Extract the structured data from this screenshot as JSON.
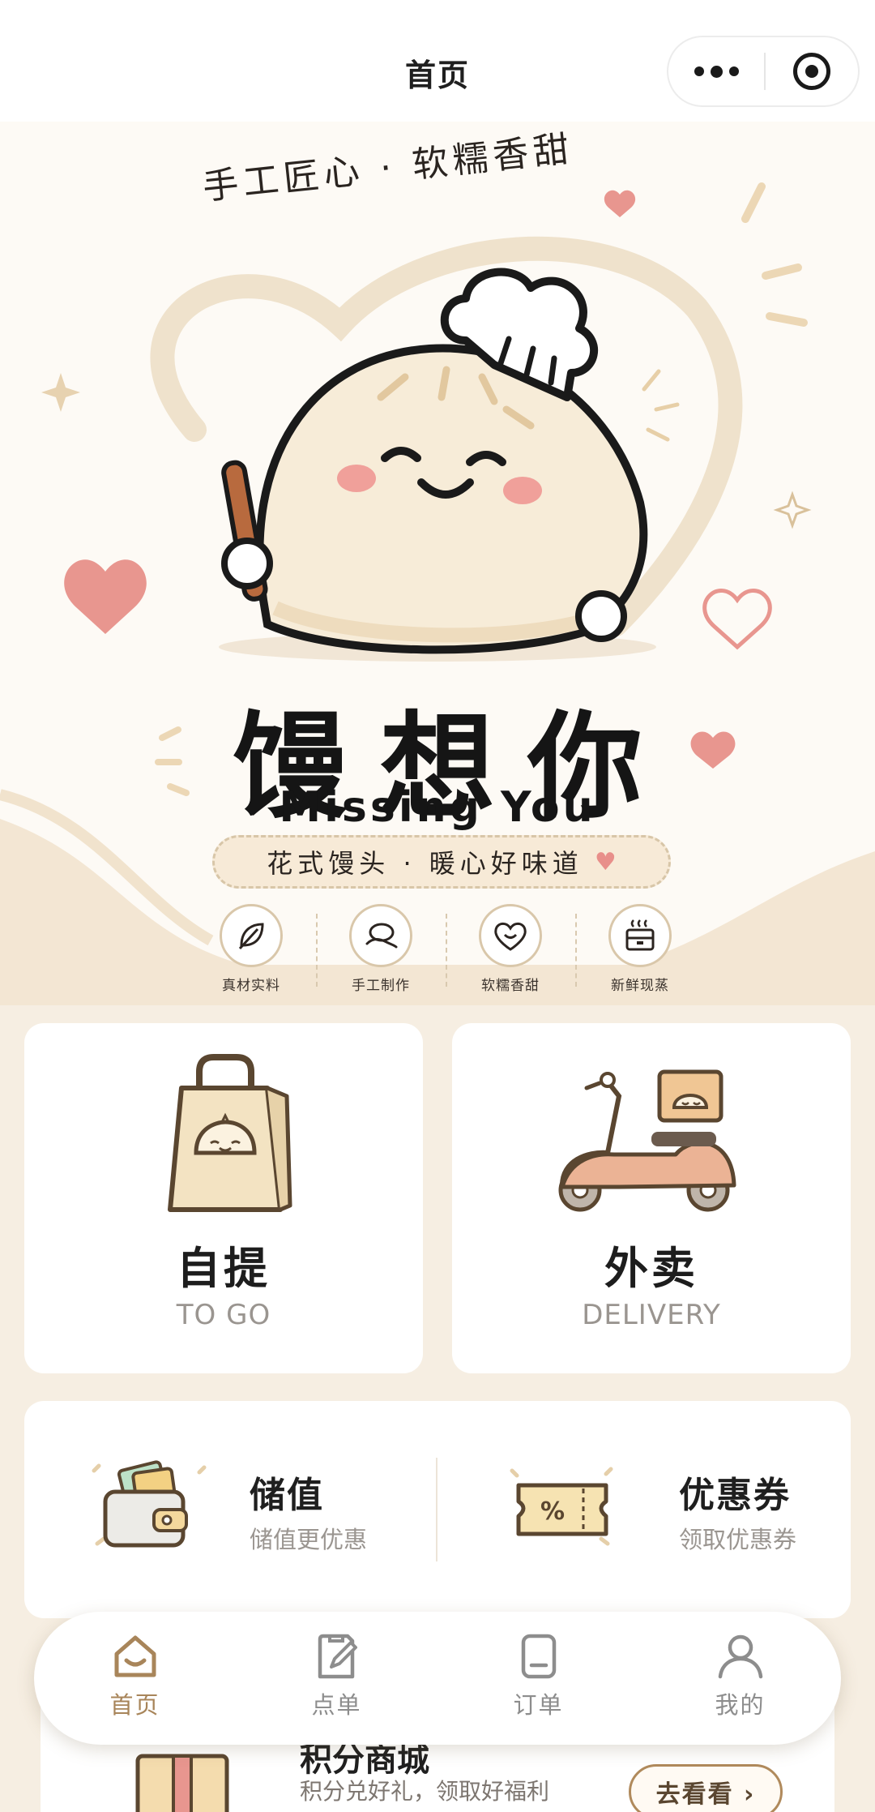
{
  "header": {
    "title": "首页",
    "more_icon": "more-dots-icon",
    "close_icon": "target-close-icon"
  },
  "banner": {
    "slogan": "手工匠心 · 软糯香甜",
    "brand_name": "馒想你",
    "brand_name_en": "Missing You",
    "tagline": "花式馒头 · 暖心好味道",
    "tagline_heart": "♥",
    "features": [
      {
        "label": "真材实料",
        "icon": "leaf-icon"
      },
      {
        "label": "手工制作",
        "icon": "hand-dough-icon"
      },
      {
        "label": "软糯香甜",
        "icon": "heart-smile-icon"
      },
      {
        "label": "新鲜现蒸",
        "icon": "steamer-icon"
      }
    ]
  },
  "order_options": [
    {
      "title": "自提",
      "subtitle": "TO GO",
      "icon": "shopping-bag-icon"
    },
    {
      "title": "外卖",
      "subtitle": "DELIVERY",
      "icon": "scooter-icon"
    }
  ],
  "services": [
    {
      "title": "储值",
      "subtitle": "储值更优惠",
      "icon": "wallet-icon"
    },
    {
      "title": "优惠券",
      "subtitle": "领取优惠券",
      "icon": "coupon-icon"
    }
  ],
  "points_mall": {
    "title": "积分商城",
    "subtitle": "积分兑好礼，领取好福利",
    "button": "去看看 ›"
  },
  "tabbar": {
    "items": [
      {
        "label": "首页",
        "icon": "home-icon",
        "active": true
      },
      {
        "label": "点单",
        "icon": "order-edit-icon",
        "active": false
      },
      {
        "label": "订单",
        "icon": "receipt-icon",
        "active": false
      },
      {
        "label": "我的",
        "icon": "user-icon",
        "active": false
      }
    ]
  },
  "colors": {
    "background": "#f6eee2",
    "accent": "#a8855a",
    "pink": "#e88f8a"
  }
}
